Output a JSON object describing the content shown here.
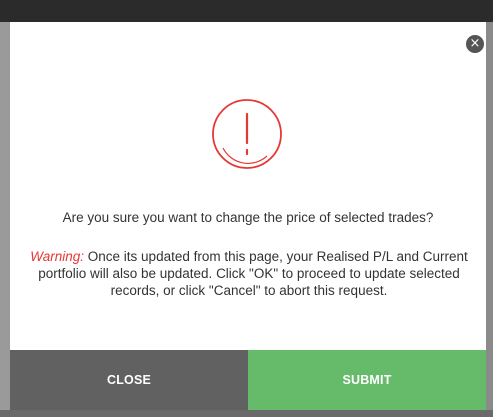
{
  "dialog": {
    "close_glyph": "×",
    "icon": "exclamation-circle-icon",
    "question": "Are you sure you want to change the price of selected trades?",
    "warning_label": "Warning:",
    "warning_text": " Once its updated from this page, your Realised P/L and Current portfolio will also be updated. Click \"OK\" to proceed to update selected records, or click \"Cancel\" to abort this request.",
    "close_button": "CLOSE",
    "submit_button": "SUBMIT"
  },
  "colors": {
    "icon_stroke": "#e53935",
    "warning_label": "#e53935",
    "close_button_bg": "#616161",
    "submit_button_bg": "#66bb6a"
  }
}
